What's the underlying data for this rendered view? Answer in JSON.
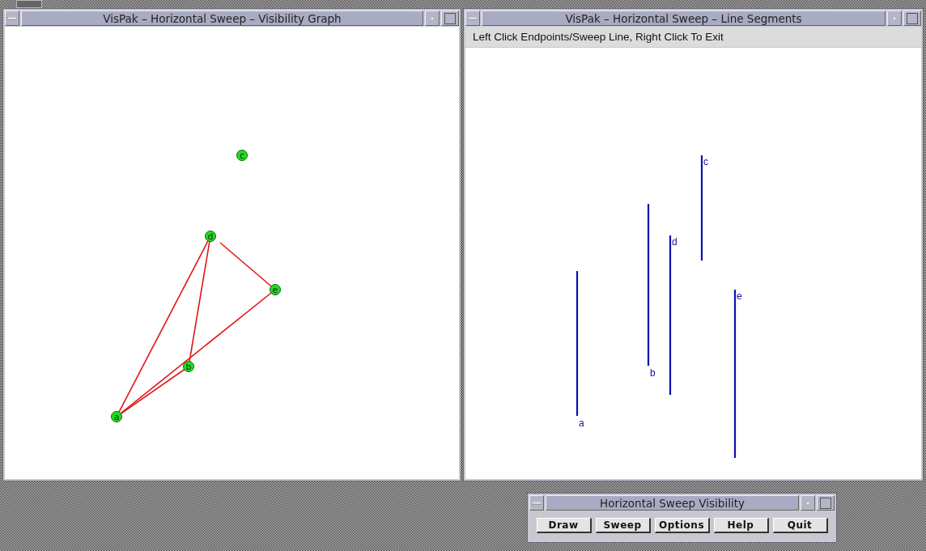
{
  "windows": [
    {
      "kind": "graph",
      "title": "VisPak – Horizontal Sweep – Visibility Graph",
      "nodes": [
        "c",
        "d",
        "e",
        "b",
        "a"
      ]
    },
    {
      "kind": "segments",
      "title": "VisPak – Horizontal Sweep – Line Segments",
      "instruction": "Left Click Endpoints/Sweep Line, Right Click To Exit",
      "segments": [
        "a",
        "b",
        "d",
        "c",
        "e"
      ]
    },
    {
      "kind": "controls",
      "title": "Horizontal Sweep Visibility",
      "buttons": [
        "Draw",
        "Sweep",
        "Options",
        "Help",
        "Quit"
      ]
    }
  ]
}
